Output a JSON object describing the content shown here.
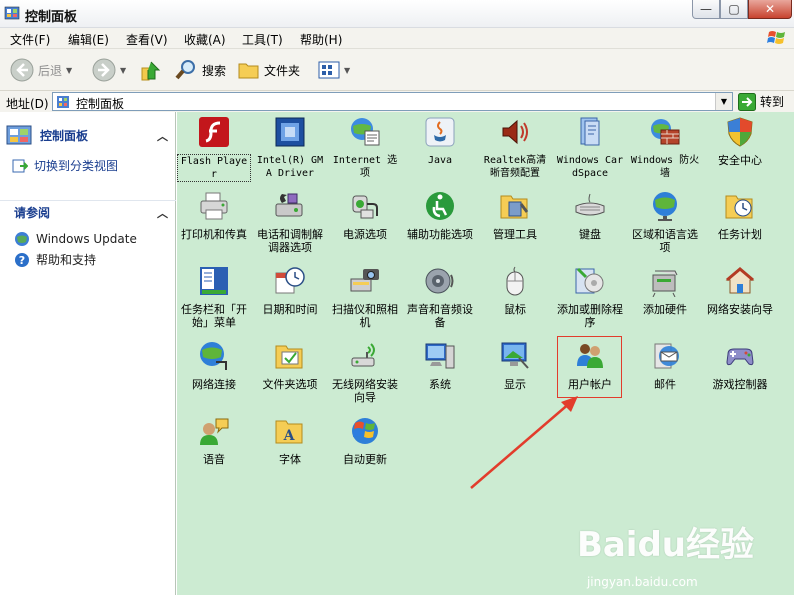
{
  "window": {
    "title": "控制面板"
  },
  "menu": [
    "文件(F)",
    "编辑(E)",
    "查看(V)",
    "收藏(A)",
    "工具(T)",
    "帮助(H)"
  ],
  "toolbar": {
    "back": "后退",
    "search": "搜索",
    "folders": "文件夹"
  },
  "address": {
    "label": "地址(D)",
    "value": "控制面板",
    "go": "转到"
  },
  "sidebar": {
    "panel1_title": "控制面板",
    "switch_view": "切换到分类视图",
    "panel2_title": "请参阅",
    "windows_update": "Windows Update",
    "help": "帮助和支持"
  },
  "items": [
    "Flash Player",
    "Intel(R) GMA Driver",
    "Internet 选项",
    "Java",
    "Realtek高清晰音频配置",
    "Windows CardSpace",
    "Windows 防火墙",
    "安全中心",
    "打印机和传真",
    "电话和调制解调器选项",
    "电源选项",
    "辅助功能选项",
    "管理工具",
    "键盘",
    "区域和语言选项",
    "任务计划",
    "任务栏和「开始」菜单",
    "日期和时间",
    "扫描仪和照相机",
    "声音和音频设备",
    "鼠标",
    "添加或删除程序",
    "添加硬件",
    "网络安装向导",
    "网络连接",
    "文件夹选项",
    "无线网络安装向导",
    "系统",
    "显示",
    "用户帐户",
    "邮件",
    "游戏控制器",
    "语音",
    "字体",
    "自动更新"
  ],
  "watermark": {
    "brand": "Baidu经验",
    "url": "jingyan.baidu.com"
  },
  "colors": {
    "content_bg": "#ccebd2",
    "highlight": "#e23c2c",
    "link": "#1a3e8f"
  }
}
